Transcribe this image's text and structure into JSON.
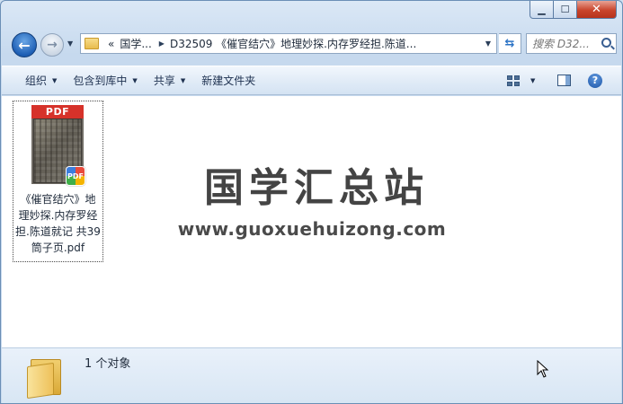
{
  "address": {
    "segments": [
      "«",
      "国学...",
      "D32509 《催官结穴》地理妙探.内存罗经担.陈道..."
    ],
    "current_path_short": "D32509 《催官结穴》地理妙探.内存罗经担.陈道..."
  },
  "search": {
    "placeholder": "搜索 D32..."
  },
  "commands": {
    "organize": "组织",
    "include_library": "包含到库中",
    "share": "共享",
    "new_folder": "新建文件夹"
  },
  "file": {
    "thumb_label": "PDF",
    "badge_label": "PDF",
    "name": "《催官结穴》地理妙探.内存罗经担.陈道就记 共39筒子页.pdf"
  },
  "watermark": {
    "title": "国学汇总站",
    "url": "www.guoxuehuizong.com"
  },
  "details": {
    "count_text": "1 个对象"
  },
  "caption": {
    "min": "▁",
    "max": "☐",
    "close": "✕"
  },
  "icons": {
    "back": "arrow-left-icon",
    "forward": "arrow-right-icon",
    "refresh": "refresh-icon",
    "search": "search-icon",
    "views": "view-grid-icon",
    "preview_pane": "preview-pane-icon",
    "help": "help-icon",
    "folder": "folder-icon",
    "cursor": "mouse-cursor-icon"
  }
}
